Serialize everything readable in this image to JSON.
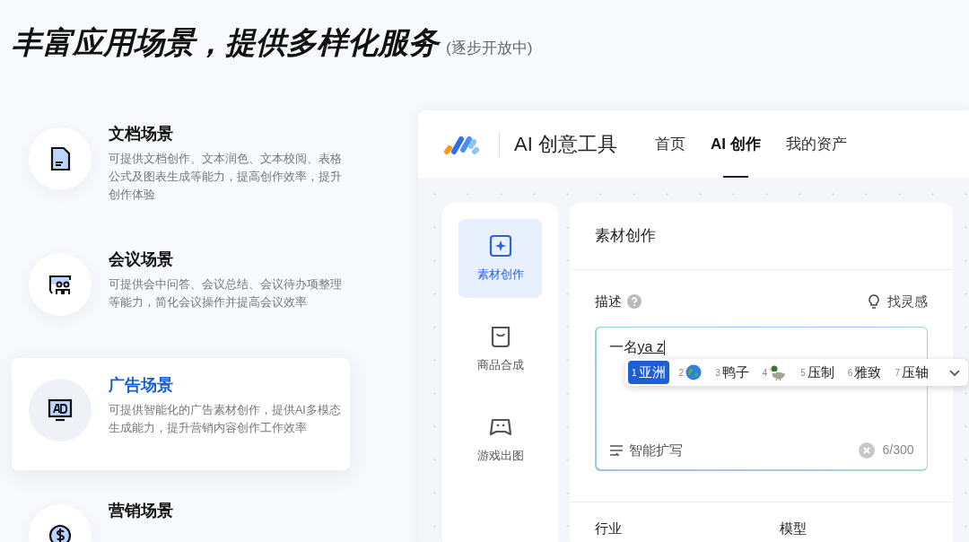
{
  "heading": {
    "title": "丰富应用场景，提供多样化服务",
    "note": "(逐步开放中)"
  },
  "scenes": [
    {
      "kind": "document",
      "title": "文档场景",
      "description": "可提供文档创作、文本润色、文本校阅、表格公式及图表生成等能力，提高创作效率，提升创作体验",
      "selected": false
    },
    {
      "kind": "meeting",
      "title": "会议场景",
      "description": "可提供会中问答、会议总结、会议待办项整理等能力，简化会议操作并提高会议效率",
      "selected": false
    },
    {
      "kind": "ad",
      "title": "广告场景",
      "description": "可提供智能化的广告素材创作，提供AI多模态生成能力，提升营销内容创作工作效率",
      "selected": true
    },
    {
      "kind": "marketing",
      "title": "营销场景",
      "selected": false
    }
  ],
  "app": {
    "title": "AI 创意工具",
    "nav": [
      {
        "label": "首页",
        "selected": false
      },
      {
        "label": "AI 创作",
        "selected": true
      },
      {
        "label": "我的资产",
        "selected": false
      }
    ],
    "sidebar": [
      {
        "kind": "material",
        "label": "素材创作",
        "selected": true
      },
      {
        "kind": "product",
        "label": "商品合成",
        "selected": false
      },
      {
        "kind": "game",
        "label": "游戏出图",
        "selected": false
      }
    ],
    "panel_title": "素材创作",
    "description_label": "描述",
    "inspiration": "找灵感",
    "input": {
      "committed": "一名",
      "composing": "ya z"
    },
    "candidates": [
      {
        "index": "1",
        "kind": "text",
        "text": "亚洲",
        "selected": true
      },
      {
        "index": "2",
        "kind": "globe",
        "selected": false
      },
      {
        "index": "3",
        "kind": "text",
        "text": "鸭子",
        "selected": false
      },
      {
        "index": "4",
        "kind": "duck",
        "selected": false
      },
      {
        "index": "5",
        "kind": "text",
        "text": "压制",
        "selected": false
      },
      {
        "index": "6",
        "kind": "text",
        "text": "雅致",
        "selected": false
      },
      {
        "index": "7",
        "kind": "text",
        "text": "压轴",
        "selected": false
      }
    ],
    "expand": "智能扩写",
    "counter": "6/300",
    "fields": [
      "行业",
      "模型"
    ]
  }
}
